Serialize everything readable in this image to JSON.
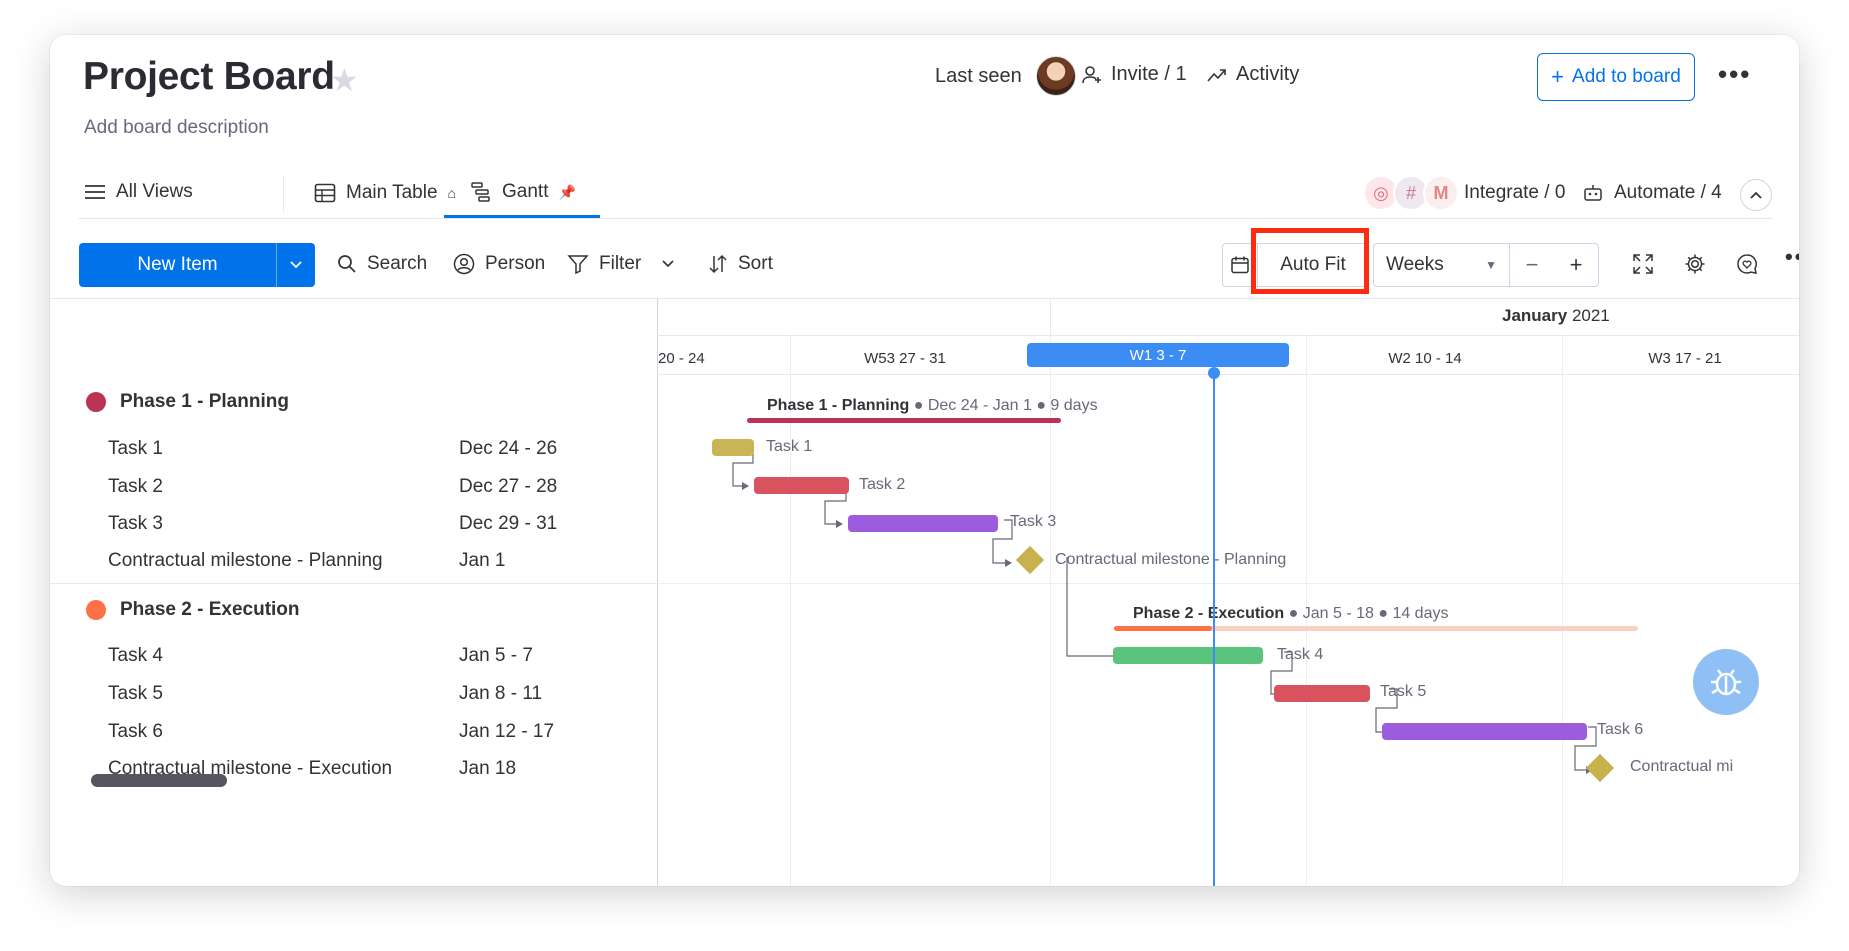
{
  "board": {
    "title": "Project Board",
    "description": "Add board description"
  },
  "header": {
    "last_seen_label": "Last seen",
    "invite_label": "Invite / 1",
    "activity_label": "Activity",
    "add_to_board_label": "Add to board",
    "more_label": "•••"
  },
  "views": {
    "all_views_label": "All Views",
    "tabs": [
      {
        "label": "Main Table"
      },
      {
        "label": "Gantt"
      }
    ],
    "integrate_label": "Integrate / 0",
    "automate_label": "Automate / 4"
  },
  "toolbar": {
    "new_item_label": "New Item",
    "search_label": "Search",
    "person_label": "Person",
    "filter_label": "Filter",
    "sort_label": "Sort",
    "auto_fit_label": "Auto Fit",
    "zoom_select_value": "Weeks",
    "zoom_out_label": "−",
    "zoom_in_label": "+",
    "more_label": "•••"
  },
  "timeline": {
    "month": "January",
    "year": "2021",
    "weeks": [
      {
        "label": "20 - 24"
      },
      {
        "label": "W53   27 - 31"
      },
      {
        "label": "W1   3 - 7",
        "current": true
      },
      {
        "label": "W2   10 - 14"
      },
      {
        "label": "W3   17 - 21"
      }
    ]
  },
  "groups": [
    {
      "name": "Phase 1 - Planning",
      "color": "#bb3354",
      "summary_name": "Phase 1 - Planning",
      "summary_meta": " ● Dec 24 - Jan 1 ● 9 days",
      "items": [
        {
          "name": "Task 1",
          "date": "Dec 24 - 26",
          "color": "#c9b555"
        },
        {
          "name": "Task 2",
          "date": "Dec 27 - 28",
          "color": "#d9535f"
        },
        {
          "name": "Task 3",
          "date": "Dec 29 - 31",
          "color": "#9d5cde"
        },
        {
          "name": "Contractual milestone - Planning",
          "date": "Jan 1",
          "color": "#c9b555"
        }
      ]
    },
    {
      "name": "Phase 2 - Execution",
      "color": "#ff7043",
      "summary_name": "Phase 2 - Execution",
      "summary_meta": " ● Jan 5 - 18 ● 14 days",
      "items": [
        {
          "name": "Task 4",
          "date": "Jan 5 - 7",
          "color": "#5ac47d"
        },
        {
          "name": "Task 5",
          "date": "Jan 8 - 11",
          "color": "#d9535f"
        },
        {
          "name": "Task 6",
          "date": "Jan 12 - 17",
          "color": "#9d5cde"
        },
        {
          "name": "Contractual milestone - Execution",
          "date": "Jan 18",
          "color": "#c9b555"
        }
      ]
    }
  ],
  "gantt_labels": {
    "milestone_execution_truncated": "Contractual mi"
  },
  "colors": {
    "accent": "#0073ea",
    "highlight_box": "#ff2a10"
  }
}
